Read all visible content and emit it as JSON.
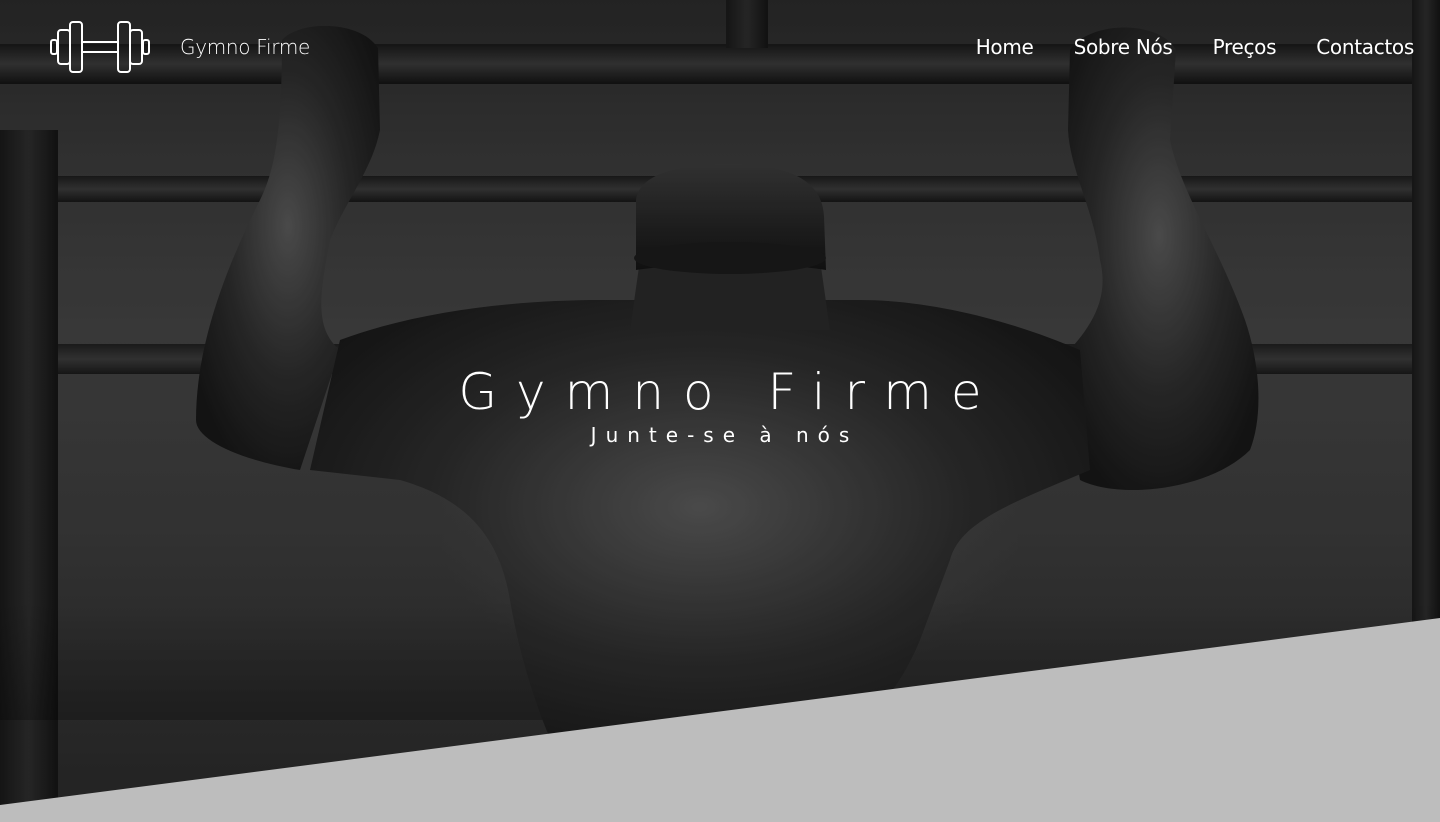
{
  "nav": {
    "brand_name": "Gymno Firme",
    "logo_icon": "dumbbell-icon",
    "links": [
      {
        "label": "Home"
      },
      {
        "label": "Sobre Nós"
      },
      {
        "label": "Preços"
      },
      {
        "label": "Contactos"
      }
    ]
  },
  "hero": {
    "title": "Gymno Firme",
    "subtitle": "Junte-se à nós",
    "background_image": "grayscale photo of a muscular man doing pull-ups on a gym rack"
  },
  "colors": {
    "text": "#ffffff",
    "section_divider": "#bdbdbd"
  }
}
